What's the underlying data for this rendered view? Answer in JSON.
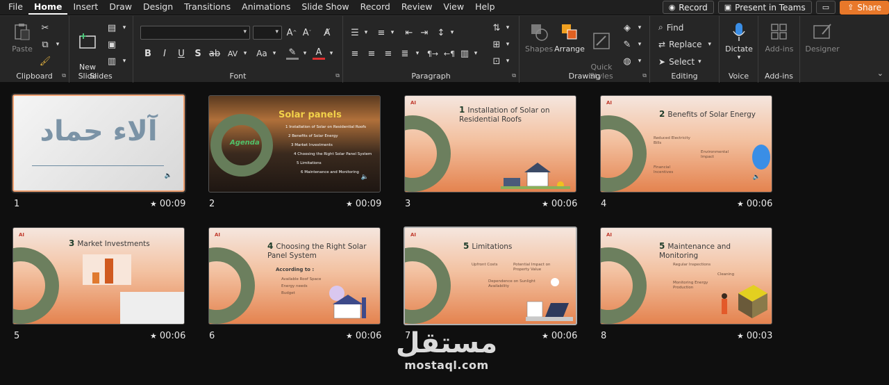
{
  "menu": {
    "items": [
      "File",
      "Home",
      "Insert",
      "Draw",
      "Design",
      "Transitions",
      "Animations",
      "Slide Show",
      "Record",
      "Review",
      "View",
      "Help"
    ],
    "record_button": "Record",
    "present_teams_button": "Present in Teams",
    "share_button": "Share"
  },
  "ribbon": {
    "clipboard": {
      "label": "Clipboard",
      "paste": "Paste"
    },
    "slides": {
      "label": "Slides",
      "new_slide": "New\nSlide"
    },
    "font": {
      "label": "Font"
    },
    "paragraph": {
      "label": "Paragraph"
    },
    "drawing": {
      "label": "Drawing",
      "shapes": "Shapes",
      "arrange": "Arrange",
      "quick_styles": "Quick\nStyles"
    },
    "editing": {
      "label": "Editing",
      "find": "Find",
      "replace": "Replace",
      "select": "Select"
    },
    "voice": {
      "label": "Voice",
      "dictate": "Dictate"
    },
    "addins": {
      "label": "Add-ins",
      "addins_btn": "Add-ins"
    },
    "designer": {
      "designer_btn": "Designer"
    }
  },
  "slides": [
    {
      "number": "1",
      "duration": "00:09",
      "title_ar": "آلاء حماد"
    },
    {
      "number": "2",
      "duration": "00:09",
      "title": "Solar panels",
      "agenda": "Agenda",
      "items": [
        "1 Installation of Solar on Residential Roofs",
        "2 Benefits of Solar Energy",
        "3 Market Investments",
        "4 Choosing the Right Solar Panel System",
        "5 Limitations",
        "6 Maintenance and Monitoring"
      ]
    },
    {
      "number": "3",
      "duration": "00:06",
      "num": "1",
      "title": "Installation of Solar on Residential Roofs"
    },
    {
      "number": "4",
      "duration": "00:06",
      "num": "2",
      "title": "Benefits of Solar Energy",
      "bullets": [
        "Reduced Electricity Bills",
        "Environmental Impact",
        "Financial Incentives"
      ]
    },
    {
      "number": "5",
      "duration": "00:06",
      "num": "3",
      "title": "Market Investments"
    },
    {
      "number": "6",
      "duration": "00:06",
      "num": "4",
      "title": "Choosing the Right Solar Panel System",
      "subtitle": "According to :",
      "bullets": [
        "Available Roof Space",
        "Energy needs",
        "Budget"
      ]
    },
    {
      "number": "7",
      "duration": "00:06",
      "num": "5",
      "title": "Limitations",
      "bullets": [
        "Upfront Costs",
        "Potential Impact on Property Value",
        "Dependence on Sunlight Availability"
      ]
    },
    {
      "number": "8",
      "duration": "00:03",
      "num": "5",
      "title": "Maintenance and Monitoring",
      "bullets": [
        "Regular Inspections",
        "Cleaning",
        "Monitoring Energy Production"
      ]
    }
  ],
  "watermark": {
    "arabic": "مستقل",
    "latin": "mostaql.com"
  },
  "colors": {
    "accent": "#e8782a",
    "selection": "#f0a070",
    "ribbon": "#262626"
  }
}
